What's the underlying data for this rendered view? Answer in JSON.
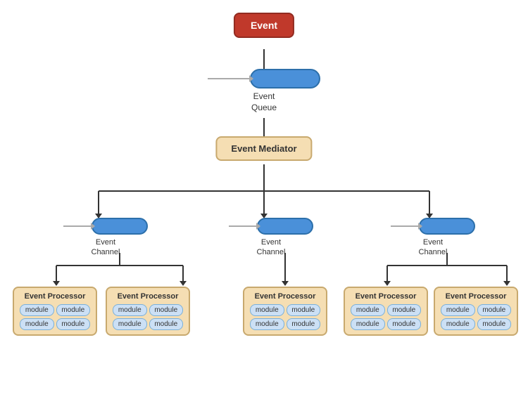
{
  "nodes": {
    "event": "Event",
    "eventQueue": "Event\nQueue",
    "eventQueueLabel": "Event",
    "eventQueueLabel2": "Queue",
    "eventMediator": "Event Mediator",
    "eventChannel": "Event",
    "eventChannelLine2": "Channel",
    "module": "module"
  },
  "processors": [
    {
      "label": "Event Processor",
      "modules": [
        "module",
        "module",
        "module",
        "module"
      ]
    },
    {
      "label": "Event Processor",
      "modules": [
        "module",
        "module",
        "module",
        "module"
      ]
    },
    {
      "label": "Event Processor",
      "modules": [
        "module",
        "module",
        "module",
        "module"
      ]
    },
    {
      "label": "Event Processor",
      "modules": [
        "module",
        "module",
        "module",
        "module"
      ]
    },
    {
      "label": "Event Processor",
      "modules": [
        "module",
        "module",
        "module",
        "module"
      ]
    }
  ],
  "channels": [
    {
      "label1": "Event",
      "label2": "Channel"
    },
    {
      "label1": "Event",
      "label2": "Channel"
    },
    {
      "label1": "Event",
      "label2": "Channel"
    }
  ]
}
